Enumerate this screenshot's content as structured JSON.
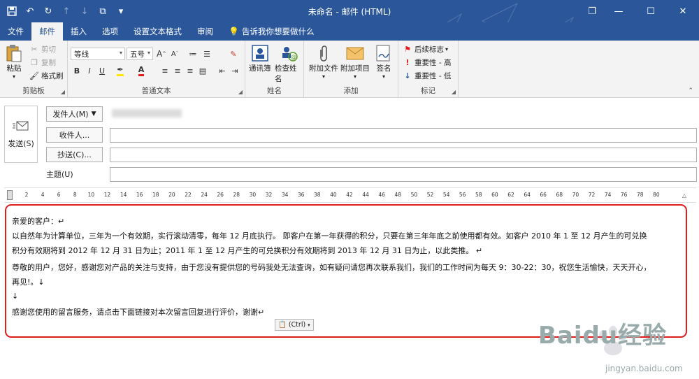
{
  "window": {
    "title": "未命名 - 邮件 (HTML)",
    "controls": {
      "restore": "❐",
      "minimize": "—",
      "maximize": "☐",
      "close": "✕"
    }
  },
  "quick_access": {
    "save_icon": "save-icon",
    "undo_icon": "undo-icon",
    "redo_icon": "redo-icon",
    "up_icon": "arrow-up-icon",
    "down_icon": "arrow-down-icon",
    "clip_icon": "clipboard-check-icon",
    "more_icon": "chevron-down-icon"
  },
  "tabs": [
    {
      "label": "文件",
      "active": false
    },
    {
      "label": "邮件",
      "active": true
    },
    {
      "label": "插入",
      "active": false
    },
    {
      "label": "选项",
      "active": false
    },
    {
      "label": "设置文本格式",
      "active": false
    },
    {
      "label": "审阅",
      "active": false
    }
  ],
  "tell_me": "告诉我你想要做什么",
  "ribbon": {
    "clipboard": {
      "label": "剪贴板",
      "paste": "粘贴",
      "cut": "剪切",
      "copy": "复制",
      "format_painter": "格式刷"
    },
    "basic_text": {
      "label": "普通文本",
      "font": "等线",
      "size": "五号",
      "bold": "B",
      "italic": "I",
      "underline": "U",
      "grow": "A",
      "shrink": "A"
    },
    "names": {
      "label": "姓名",
      "address_book": "通讯簿",
      "check_names": "检查姓名"
    },
    "include": {
      "label": "添加",
      "attach_file": "附加文件",
      "attach_item": "附加项目",
      "signature": "签名"
    },
    "tags": {
      "label": "标记",
      "follow_up": "后续标志",
      "high_importance": "重要性 - 高",
      "low_importance": "重要性 - 低"
    }
  },
  "header": {
    "send": "发送(S)",
    "from": "发件人(M)",
    "to": "收件人...",
    "cc": "抄送(C)...",
    "subject": "主题(U)"
  },
  "ruler": {
    "ticks": [
      "2",
      "4",
      "6",
      "8",
      "10",
      "12",
      "14",
      "16",
      "18",
      "20",
      "22",
      "24",
      "26",
      "28",
      "30",
      "32",
      "34",
      "36",
      "38",
      "40",
      "42",
      "44",
      "46",
      "48",
      "50",
      "52",
      "54",
      "56",
      "58",
      "60",
      "62",
      "64",
      "66",
      "68",
      "70",
      "72",
      "74",
      "76",
      "78",
      "80"
    ]
  },
  "body": {
    "lines": [
      "亲爱的客户：↵",
      "以自然年为计算单位，三年为一个有效期，实行滚动清零，每年 12 月底执行。 即客户在第一年获得的积分，只要在第三年年底之前使用都有效。如客户 2010 年 1 至 12 月产生的可兑换",
      "积分有效期将到 2012 年 12 月 31 日为止；2011 年 1 至 12 月产生的可兑换积分有效期将到 2013 年 12 月 31 日为止，以此类推。 ↵",
      "尊敬的用户，您好，感谢您对产品的关注与支持，由于您没有提供您的号码我处无法查询，如有疑问请您再次联系我们，我们的工作时间为每天 9：30-22：30，祝您生活愉快，天天开心，",
      "再见!。↓",
      "↓",
      "感谢您使用的留言服务，请点击下面链接对本次留言回复进行评价，谢谢↵"
    ],
    "paste_options": "(Ctrl)"
  },
  "watermark": {
    "brand": "Baidu经验",
    "url": "jingyan.baidu.com"
  },
  "colors": {
    "accent": "#2b579a",
    "highlight_border": "#e21b1b"
  }
}
